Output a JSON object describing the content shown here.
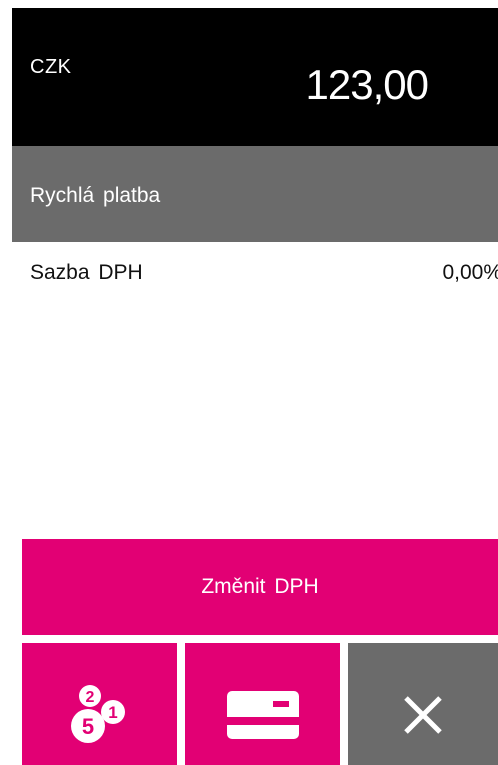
{
  "header": {
    "currency": "CZK",
    "amount": "123,00"
  },
  "payment_method": {
    "label": "Rychlá platba"
  },
  "vat": {
    "label": "Sazba DPH",
    "value": "0,00%"
  },
  "actions": {
    "change_vat_label": "Změnit DPH",
    "cash_icon": "coins-icon",
    "card_icon": "card-icon",
    "cancel_icon": "close-icon",
    "coin_numbers": [
      "2",
      "1",
      "5"
    ]
  },
  "colors": {
    "accent": "#e20074",
    "dark": "#000000",
    "gray": "#6b6b6b",
    "text_on_dark": "#ffffff"
  }
}
